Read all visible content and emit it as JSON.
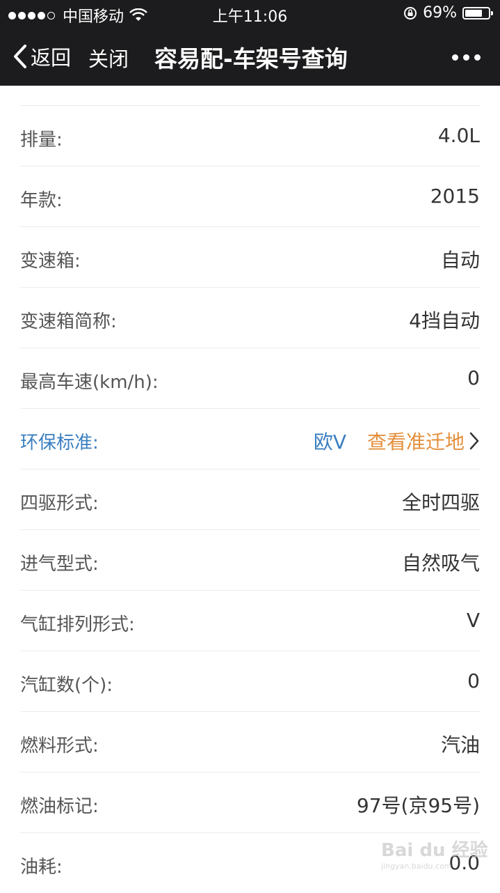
{
  "status_bar": {
    "carrier": "中国移动",
    "time": "上午11:06",
    "battery": "69%",
    "battery_level": 0.69,
    "signal_bars": 4
  },
  "nav": {
    "back": "返回",
    "close": "关闭",
    "title": "容易配-车架号查询"
  },
  "rows": [
    {
      "label": "排量:",
      "value": "4.0L"
    },
    {
      "label": "年款:",
      "value": "2015"
    },
    {
      "label": "变速箱:",
      "value": "自动"
    },
    {
      "label": "变速箱简称:",
      "value": "4挡自动"
    },
    {
      "label": "最高车速(km/h):",
      "value": "0"
    },
    {
      "label": "环保标准:",
      "value": "欧V",
      "link": "查看准迁地"
    },
    {
      "label": "四驱形式:",
      "value": "全时四驱"
    },
    {
      "label": "进气型式:",
      "value": "自然吸气"
    },
    {
      "label": "气缸排列形式:",
      "value": "V"
    },
    {
      "label": "汽缸数(个):",
      "value": "0"
    },
    {
      "label": "燃料形式:",
      "value": "汽油"
    },
    {
      "label": "燃油标记:",
      "value": "97号(京95号)"
    },
    {
      "label": "油耗:",
      "value": "0.0"
    }
  ],
  "watermark": {
    "brand": "Bai du 经验",
    "url": "jingyan.baidu.com"
  },
  "colors": {
    "nav_bg": "#1c1c1e",
    "highlight_blue": "#3a7fc1",
    "link_orange": "#e48f3c"
  }
}
